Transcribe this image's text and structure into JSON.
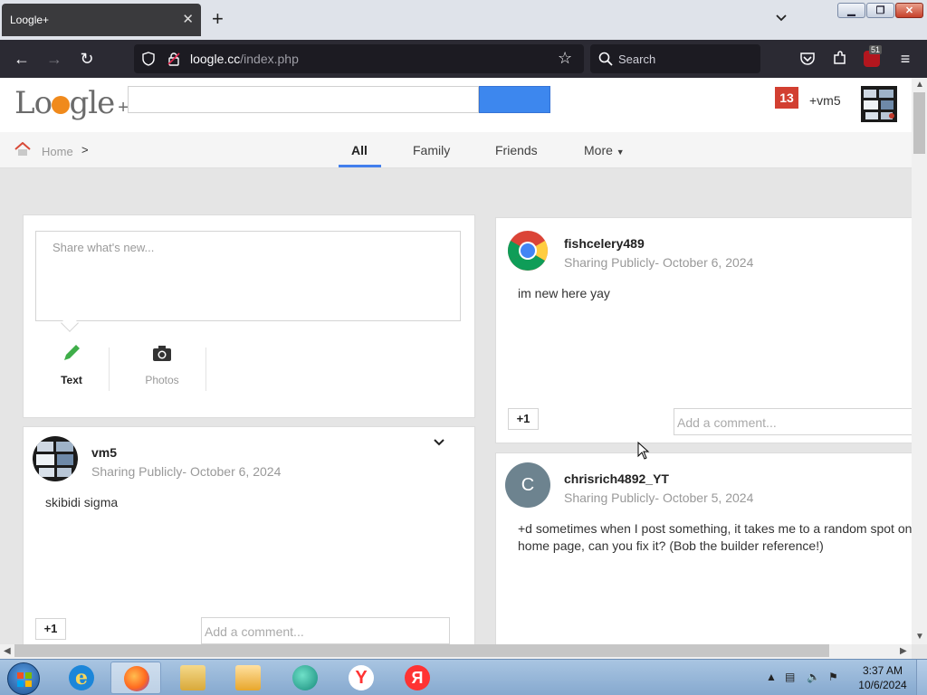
{
  "browser": {
    "tab_title": "Loogle+",
    "url_domain": "loogle.cc",
    "url_path": "/index.php",
    "search_placeholder": "Search",
    "extension_badge": "51"
  },
  "site": {
    "logo_text": "Loogle",
    "logo_plus": "+",
    "notification_count": "13",
    "user_link": "+vm5"
  },
  "nav": {
    "breadcrumb_home": "Home",
    "breadcrumb_sep": ">",
    "tabs": [
      "All",
      "Family",
      "Friends",
      "More"
    ],
    "active_tab": "All"
  },
  "composer": {
    "placeholder": "Share what's new...",
    "options": [
      "Text",
      "Photos"
    ]
  },
  "posts": [
    {
      "author": "fishcelery489",
      "visibility": "Sharing Publicly",
      "separator": "-",
      "date": "October 6, 2024",
      "body": "im new here yay",
      "plus_label": "+1",
      "comment_placeholder": "Add a comment..."
    },
    {
      "author": "vm5",
      "visibility": "Sharing Publicly",
      "separator": "-",
      "date": "October 6, 2024",
      "body": "skibidi sigma",
      "plus_label": "+1",
      "comment_placeholder": "Add a comment..."
    },
    {
      "author": "chrisrich4892_YT",
      "avatar_letter": "C",
      "visibility": "Sharing Publicly",
      "separator": "-",
      "date": "October 5, 2024",
      "body_line1": "+d sometimes when I post something, it takes me to a random spot on",
      "body_line2": "home page, can you fix it? (Bob the builder reference!)"
    }
  ],
  "taskbar": {
    "time": "3:37 AM",
    "date": "10/6/2024",
    "apps": [
      "internet-explorer",
      "firefox",
      "file-explorer",
      "media-player",
      "browser-app",
      "yandex-browser",
      "yandex"
    ]
  },
  "colors": {
    "accent_blue": "#427fed",
    "notification_red": "#d23f31",
    "page_bg": "#e5e5e5"
  }
}
